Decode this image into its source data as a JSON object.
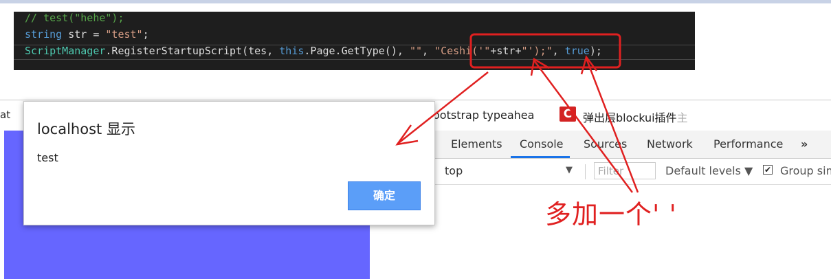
{
  "code": {
    "line1": "// test(\"hehe\");",
    "line2": {
      "kw": "string",
      "rest": " str = ",
      "str": "\"test\"",
      "end": ";"
    },
    "line3": {
      "type": "ScriptManager",
      "p1": ".RegisterStartupScript(tes, ",
      "kw_this": "this",
      "p2": ".Page.GetType(), ",
      "s1": "\"\"",
      "p3": ", ",
      "s2a": "\"Ceshi('\"",
      "p4": "+str+",
      "s2b": "\"');\"",
      "p5": ", ",
      "kw_true": "true",
      "p6": ");"
    }
  },
  "browser": {
    "left_tab": "at",
    "bookmark1_visible": "ootstrap typeahea",
    "bookmark2_icon": "C",
    "bookmark2_visible": "弹出层blockui插件",
    "bookmark2_fade": "主"
  },
  "devtools": {
    "tabs": [
      "Elements",
      "Console",
      "Sources",
      "Network",
      "Performance"
    ],
    "more": "»",
    "context": "top",
    "filter_placeholder": "Filter",
    "levels": "Default levels ▼",
    "group_label": "Group sim"
  },
  "dialog": {
    "title": "localhost 显示",
    "message": "test",
    "ok": "确定"
  },
  "annotation": {
    "text": "多加一个'  '",
    "color": "#e02020"
  }
}
